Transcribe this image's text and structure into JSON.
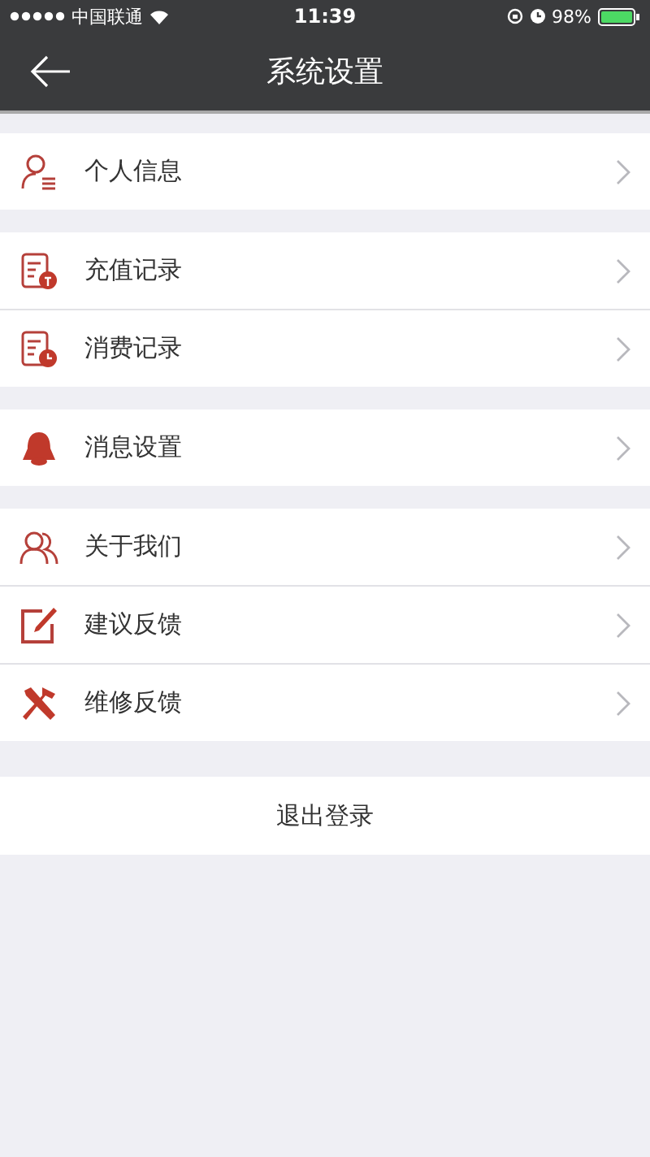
{
  "status_bar": {
    "carrier": "中国联通",
    "time": "11:39",
    "battery_text": "98%"
  },
  "nav_bar": {
    "title": "系统设置"
  },
  "groups": [
    {
      "items": [
        {
          "label": "个人信息"
        }
      ]
    },
    {
      "items": [
        {
          "label": "充值记录"
        },
        {
          "label": "消费记录"
        }
      ]
    },
    {
      "items": [
        {
          "label": "消息设置"
        }
      ]
    },
    {
      "items": [
        {
          "label": "关于我们"
        },
        {
          "label": "建议反馈"
        },
        {
          "label": "维修反馈"
        }
      ]
    }
  ],
  "logout_button": "退出登录"
}
